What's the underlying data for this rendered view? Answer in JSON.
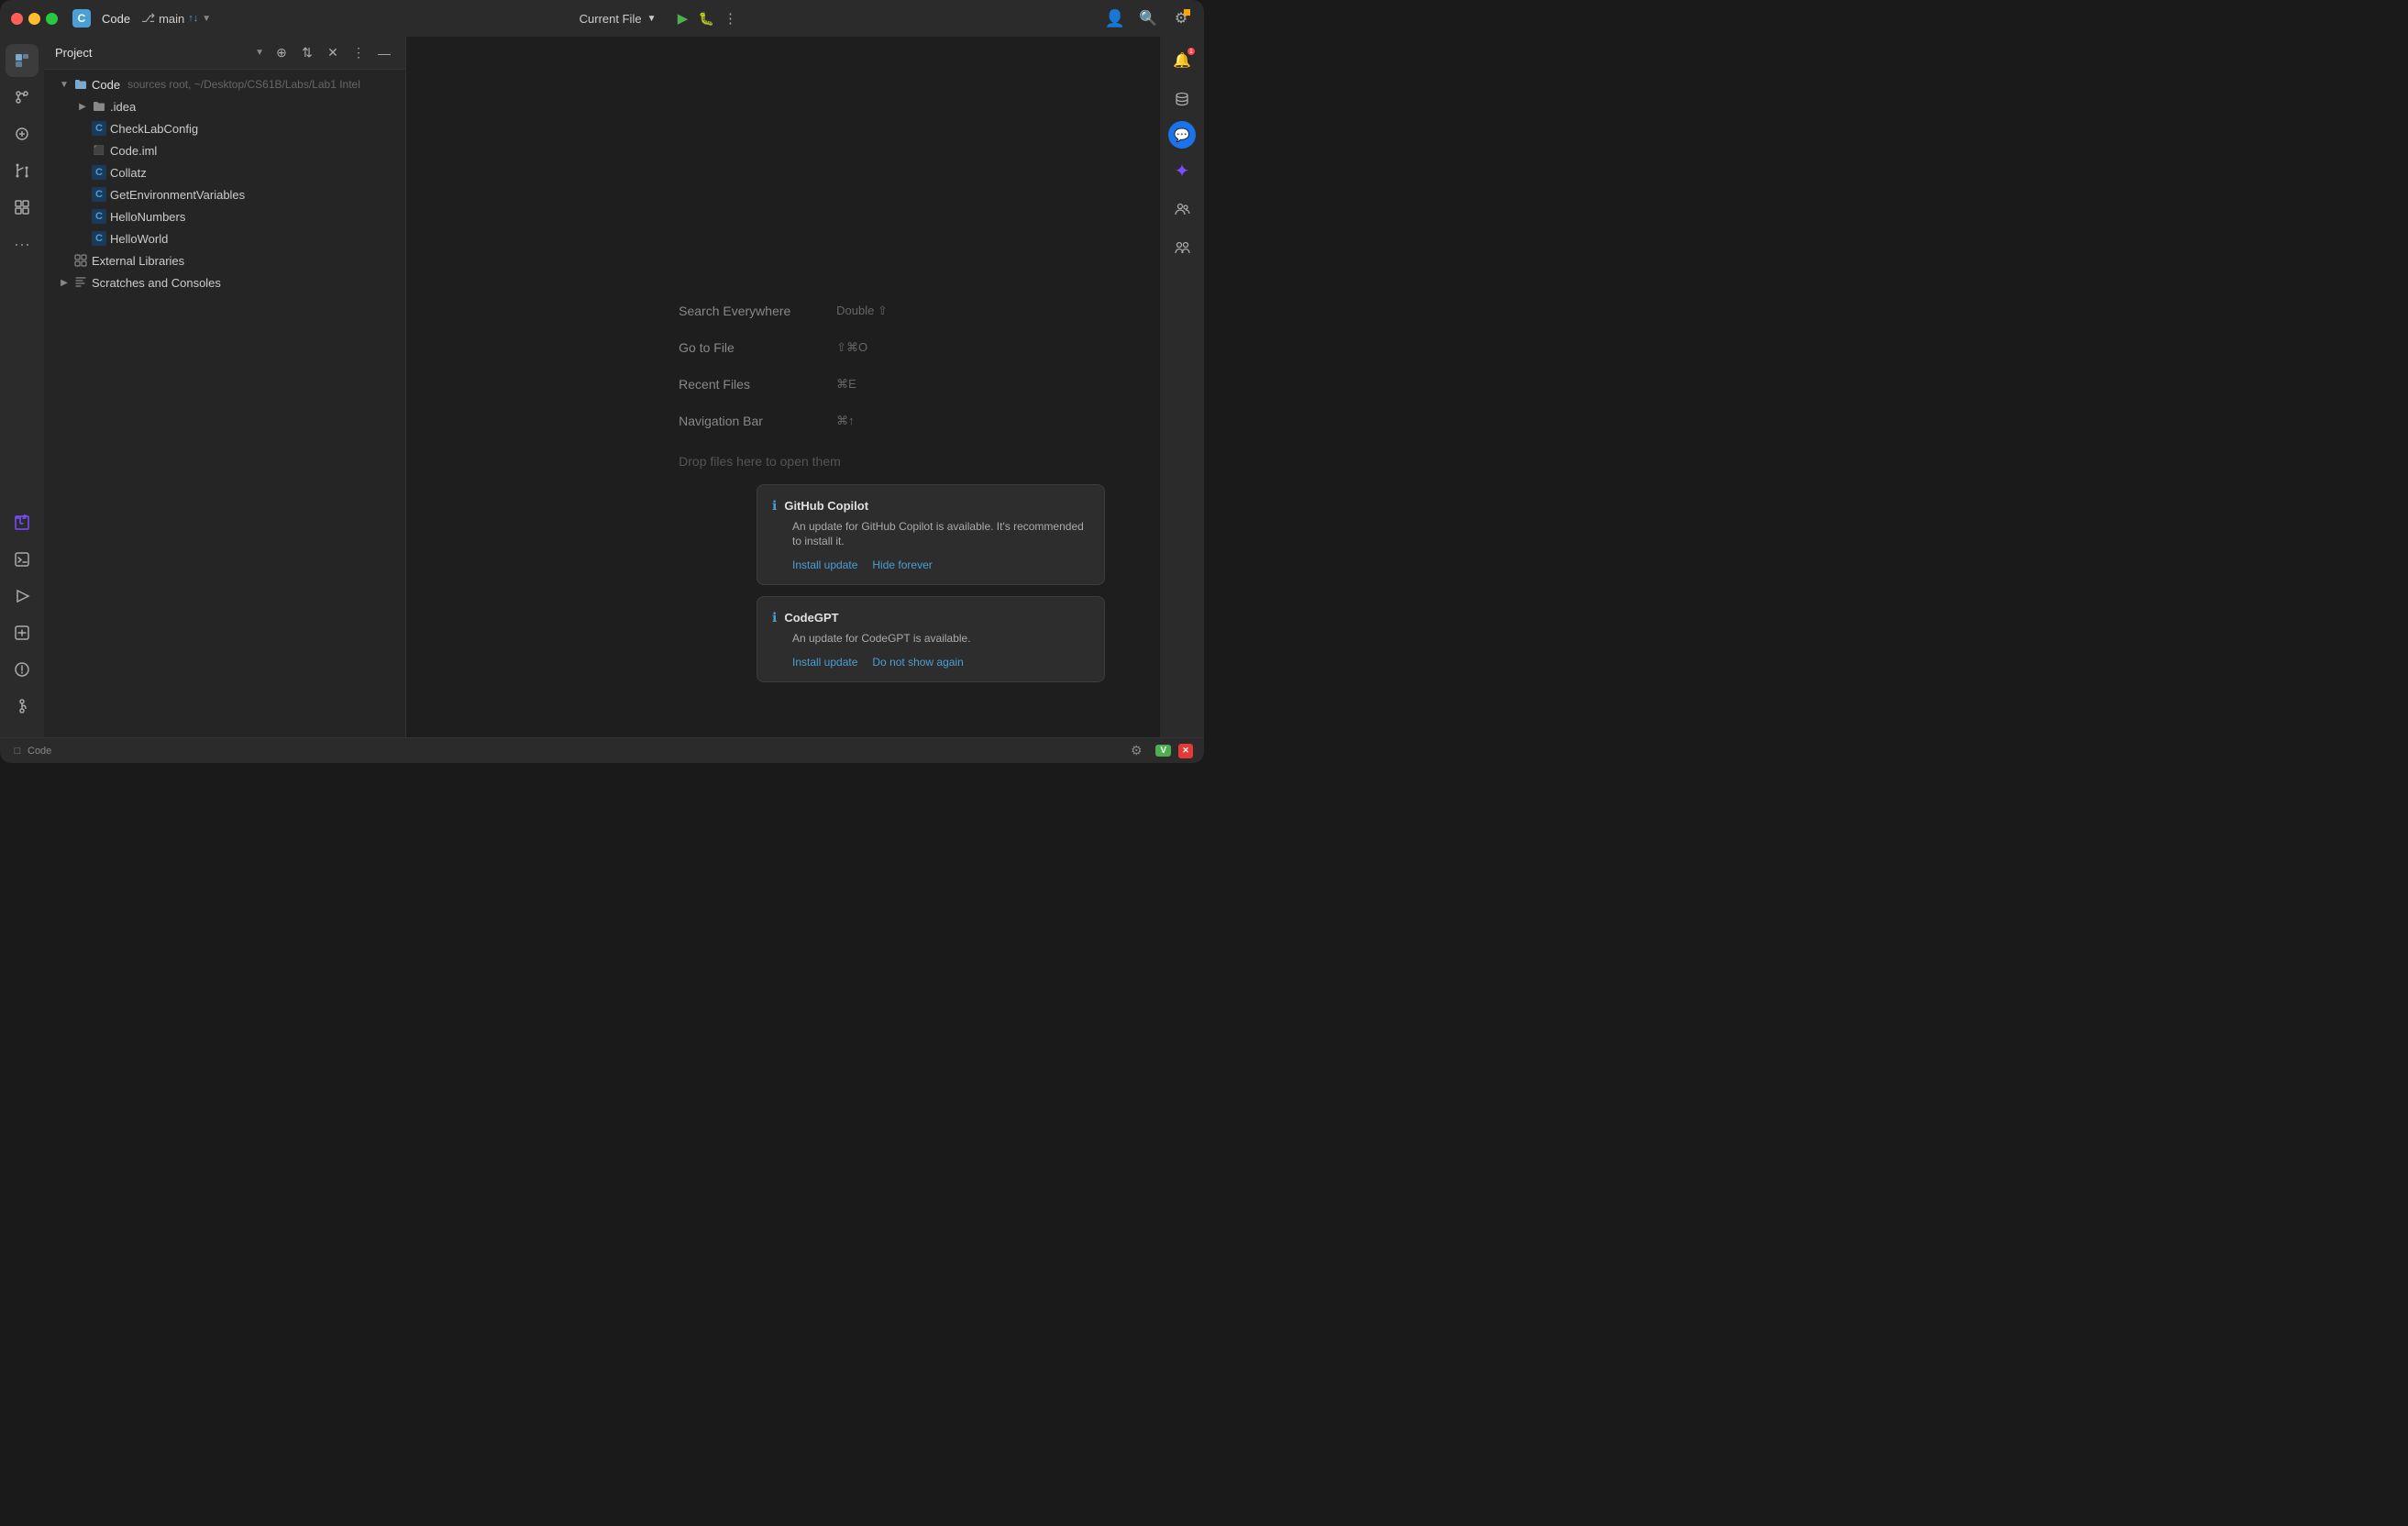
{
  "titlebar": {
    "project_badge": "C",
    "project_name": "Code",
    "branch": "main",
    "branch_arrows": "↑↓",
    "current_file": "Current File",
    "run_label": "▶",
    "settings_label": "⚙",
    "more_label": "⋮",
    "person_label": "👤",
    "search_label": "🔍",
    "gear_label": "⚙"
  },
  "panel": {
    "title": "Project",
    "actions": [
      "⊕",
      "↕",
      "✕",
      "⋮",
      "—"
    ]
  },
  "file_tree": {
    "root": {
      "label": "Code",
      "path": "sources root, ~/Desktop/CS61B/Labs/Lab1 Intel",
      "expanded": true
    },
    "items": [
      {
        "id": "idea",
        "label": ".idea",
        "type": "folder",
        "indent": 2,
        "expanded": false
      },
      {
        "id": "checklabconfig",
        "label": "CheckLabConfig",
        "type": "class",
        "indent": 2
      },
      {
        "id": "code-iml",
        "label": "Code.iml",
        "type": "iml",
        "indent": 2
      },
      {
        "id": "collatz",
        "label": "Collatz",
        "type": "class",
        "indent": 2
      },
      {
        "id": "getenvironmentvariables",
        "label": "GetEnvironmentVariables",
        "type": "class",
        "indent": 2
      },
      {
        "id": "hellonumbers",
        "label": "HelloNumbers",
        "type": "class",
        "indent": 2
      },
      {
        "id": "helloworld",
        "label": "HelloWorld",
        "type": "class",
        "indent": 2
      },
      {
        "id": "external-libraries",
        "label": "External Libraries",
        "type": "lib",
        "indent": 1,
        "expanded": false
      },
      {
        "id": "scratches",
        "label": "Scratches and Consoles",
        "type": "scratch",
        "indent": 1,
        "expanded": false
      }
    ]
  },
  "editor": {
    "hints": [
      {
        "id": "search-everywhere",
        "label": "Search Everywhere",
        "shortcut": "Double ⇧"
      },
      {
        "id": "go-to-file",
        "label": "Go to File",
        "shortcut": "⇧⌘O"
      },
      {
        "id": "recent-files",
        "label": "Recent Files",
        "shortcut": "⌘E"
      },
      {
        "id": "navigation-bar",
        "label": "Navigation Bar",
        "shortcut": "⌘↑"
      }
    ],
    "drop_text": "Drop files here to open them"
  },
  "notifications": [
    {
      "id": "github-copilot",
      "title": "GitHub Copilot",
      "body": "An update for GitHub Copilot is available. It's recommended to install it.",
      "actions": [
        "Install update",
        "Hide forever"
      ]
    },
    {
      "id": "codegpt",
      "title": "CodeGPT",
      "body": "An update for CodeGPT is available.",
      "actions": [
        "Install update",
        "Do not show again"
      ]
    }
  ],
  "status_bar": {
    "project_label": "Code",
    "folder_icon": "□"
  },
  "right_sidebar": {
    "buttons": [
      {
        "id": "notifications",
        "icon": "🔔",
        "badge": true
      },
      {
        "id": "database",
        "icon": "🗄"
      },
      {
        "id": "chat",
        "icon": "💬",
        "blue": true
      },
      {
        "id": "ai",
        "icon": "✦"
      },
      {
        "id": "team",
        "icon": "👥"
      },
      {
        "id": "collab",
        "icon": "🤝"
      }
    ]
  }
}
